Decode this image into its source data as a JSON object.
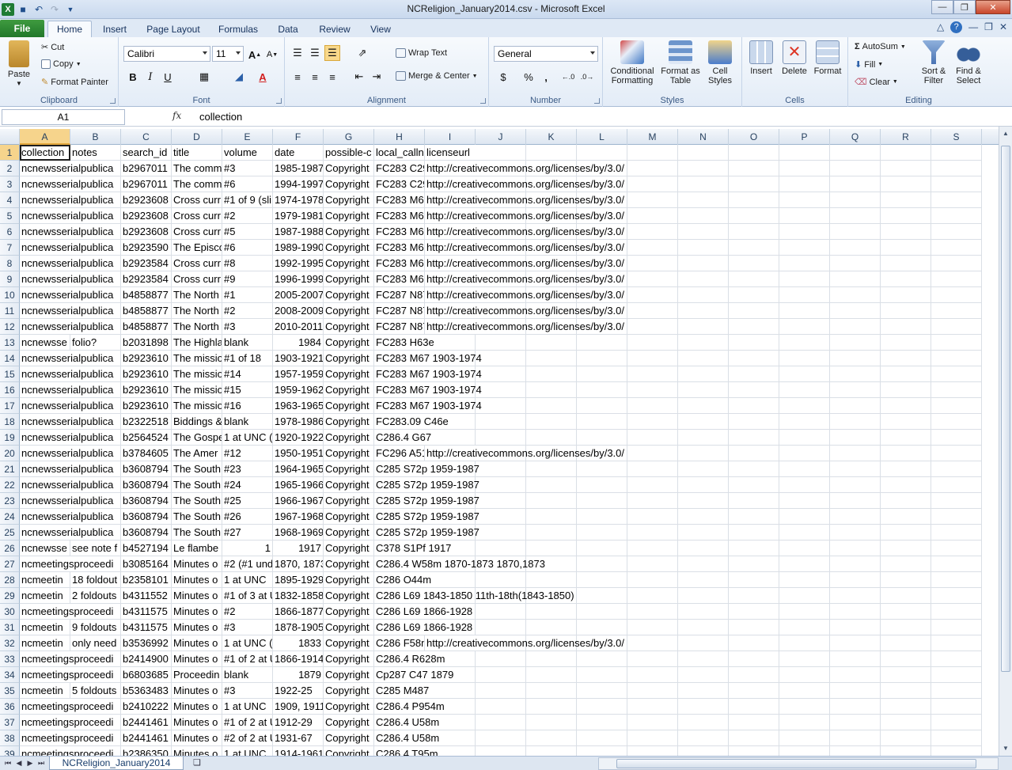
{
  "window": {
    "title": "NCReligion_January2014.csv  -  Microsoft Excel",
    "app_icon": "excel-icon"
  },
  "tabs": {
    "file": "File",
    "items": [
      "Home",
      "Insert",
      "Page Layout",
      "Formulas",
      "Data",
      "Review",
      "View"
    ],
    "active": "Home"
  },
  "ribbon": {
    "clipboard": {
      "label": "Clipboard",
      "paste": "Paste",
      "cut": "Cut",
      "copy": "Copy",
      "format_painter": "Format Painter"
    },
    "font": {
      "label": "Font",
      "name": "Calibri",
      "size": "11",
      "bold": "B",
      "italic": "I",
      "underline": "U"
    },
    "alignment": {
      "label": "Alignment",
      "wrap": "Wrap Text",
      "merge": "Merge & Center"
    },
    "number": {
      "label": "Number",
      "format": "General",
      "currency": "$",
      "percent": "%",
      "comma": ","
    },
    "styles": {
      "label": "Styles",
      "conditional": "Conditional Formatting",
      "format_table": "Format as Table",
      "cell_styles": "Cell Styles"
    },
    "cells": {
      "label": "Cells",
      "insert": "Insert",
      "delete": "Delete",
      "format": "Format"
    },
    "editing": {
      "label": "Editing",
      "autosum": "AutoSum",
      "fill": "Fill",
      "clear": "Clear",
      "sort": "Sort & Filter",
      "find": "Find & Select"
    }
  },
  "formula_bar": {
    "name_box": "A1",
    "fx": "fx",
    "value": "collection"
  },
  "columns": [
    "A",
    "B",
    "C",
    "D",
    "E",
    "F",
    "G",
    "H",
    "I",
    "J",
    "K",
    "L",
    "M",
    "N",
    "O",
    "P",
    "Q",
    "R",
    "S"
  ],
  "rows": [
    {
      "n": "1",
      "c": [
        "collection",
        "notes",
        "search_id",
        "title",
        "volume",
        "date",
        "possible-c",
        "local_calln",
        "licenseurl"
      ]
    },
    {
      "n": "2",
      "c": [
        "ncnewsserialpublica",
        "",
        "b2967011",
        "The comm",
        "#3",
        "1985-1987",
        "Copyright",
        "FC283 C29",
        "http://creativecommons.org/licenses/by/3.0/"
      ]
    },
    {
      "n": "3",
      "c": [
        "ncnewsserialpublica",
        "",
        "b2967011",
        "The comm",
        "#6",
        "1994-1997",
        "Copyright",
        "FC283 C29",
        "http://creativecommons.org/licenses/by/3.0/"
      ]
    },
    {
      "n": "4",
      "c": [
        "ncnewsserialpublica",
        "",
        "b2923608",
        "Cross curr",
        "#1 of 9 (sli",
        "1974-1978",
        "Copyright",
        "FC283 M67",
        "http://creativecommons.org/licenses/by/3.0/"
      ]
    },
    {
      "n": "5",
      "c": [
        "ncnewsserialpublica",
        "",
        "b2923608",
        "Cross curr",
        "#2",
        "1979-1981",
        "Copyright",
        "FC283 M67",
        "http://creativecommons.org/licenses/by/3.0/"
      ]
    },
    {
      "n": "6",
      "c": [
        "ncnewsserialpublica",
        "",
        "b2923608",
        "Cross curr",
        "#5",
        "1987-1988",
        "Copyright",
        "FC283 M67",
        "http://creativecommons.org/licenses/by/3.0/"
      ]
    },
    {
      "n": "7",
      "c": [
        "ncnewsserialpublica",
        "",
        "b2923590",
        "The Episco",
        "#6",
        "1989-1990",
        "Copyright",
        "FC283 M67",
        "http://creativecommons.org/licenses/by/3.0/"
      ]
    },
    {
      "n": "8",
      "c": [
        "ncnewsserialpublica",
        "",
        "b2923584",
        "Cross curr",
        "#8",
        "1992-1995",
        "Copyright",
        "FC283 M67",
        "http://creativecommons.org/licenses/by/3.0/"
      ]
    },
    {
      "n": "9",
      "c": [
        "ncnewsserialpublica",
        "",
        "b2923584",
        "Cross curr",
        "#9",
        "1996-1999",
        "Copyright",
        "FC283 M67",
        "http://creativecommons.org/licenses/by/3.0/"
      ]
    },
    {
      "n": "10",
      "c": [
        "ncnewsserialpublica",
        "",
        "b4858877",
        "The North",
        "#1",
        "2005-2007",
        "Copyright",
        "FC287 N87",
        "http://creativecommons.org/licenses/by/3.0/"
      ]
    },
    {
      "n": "11",
      "c": [
        "ncnewsserialpublica",
        "",
        "b4858877",
        "The North",
        "#2",
        "2008-2009",
        "Copyright",
        "FC287 N87",
        "http://creativecommons.org/licenses/by/3.0/"
      ]
    },
    {
      "n": "12",
      "c": [
        "ncnewsserialpublica",
        "",
        "b4858877",
        "The North",
        "#3",
        "2010-2011",
        "Copyright",
        "FC287 N87",
        "http://creativecommons.org/licenses/by/3.0/"
      ]
    },
    {
      "n": "13",
      "c": [
        "ncnewsse",
        "folio?",
        "b2031898",
        "The Highla",
        "blank",
        "1984",
        "Copyright",
        "FC283 H63e",
        ""
      ]
    },
    {
      "n": "14",
      "c": [
        "ncnewsserialpublica",
        "",
        "b2923610",
        "The missio",
        "#1 of 18",
        "1903-1921",
        "Copyright",
        "FC283 M67 1903-1974",
        ""
      ]
    },
    {
      "n": "15",
      "c": [
        "ncnewsserialpublica",
        "",
        "b2923610",
        "The missio",
        "#14",
        "1957-1959",
        "Copyright",
        "FC283 M67 1903-1974",
        ""
      ]
    },
    {
      "n": "16",
      "c": [
        "ncnewsserialpublica",
        "",
        "b2923610",
        "The missio",
        "#15",
        "1959-1962",
        "Copyright",
        "FC283 M67 1903-1974",
        ""
      ]
    },
    {
      "n": "17",
      "c": [
        "ncnewsserialpublica",
        "",
        "b2923610",
        "The missio",
        "#16",
        "1963-1965",
        "Copyright",
        "FC283 M67 1903-1974",
        ""
      ]
    },
    {
      "n": "18",
      "c": [
        "ncnewsserialpublica",
        "",
        "b2322518",
        "Biddings &",
        "blank",
        "1978-1986",
        "Copyright",
        "FC283.09 C46e",
        ""
      ]
    },
    {
      "n": "19",
      "c": [
        "ncnewsserialpublica",
        "",
        "b2564524",
        "The Gospe",
        "1 at UNC (",
        "1920-1922",
        "Copyright",
        "C286.4 G67",
        ""
      ]
    },
    {
      "n": "20",
      "c": [
        "ncnewsserialpublica",
        "",
        "b3784605",
        "The Amer",
        "#12",
        "1950-1951",
        "Copyright",
        "FC296 A51",
        "http://creativecommons.org/licenses/by/3.0/"
      ]
    },
    {
      "n": "21",
      "c": [
        "ncnewsserialpublica",
        "",
        "b3608794",
        "The South",
        "#23",
        "1964-1965",
        "Copyright",
        "C285 S72p 1959-1987",
        ""
      ]
    },
    {
      "n": "22",
      "c": [
        "ncnewsserialpublica",
        "",
        "b3608794",
        "The South",
        "#24",
        "1965-1966",
        "Copyright",
        "C285 S72p 1959-1987",
        ""
      ]
    },
    {
      "n": "23",
      "c": [
        "ncnewsserialpublica",
        "",
        "b3608794",
        "The South",
        "#25",
        "1966-1967",
        "Copyright",
        "C285 S72p 1959-1987",
        ""
      ]
    },
    {
      "n": "24",
      "c": [
        "ncnewsserialpublica",
        "",
        "b3608794",
        "The South",
        "#26",
        "1967-1968",
        "Copyright",
        "C285 S72p 1959-1987",
        ""
      ]
    },
    {
      "n": "25",
      "c": [
        "ncnewsserialpublica",
        "",
        "b3608794",
        "The South",
        "#27",
        "1968-1969",
        "Copyright",
        "C285 S72p 1959-1987",
        ""
      ]
    },
    {
      "n": "26",
      "c": [
        "ncnewsse",
        "see note f",
        "b4527194",
        "Le flambe",
        "1",
        "1917",
        "Copyright",
        "C378 S1Pf 1917",
        ""
      ]
    },
    {
      "n": "27",
      "c": [
        "ncmeetingsproceedi",
        "",
        "b3085164",
        "Minutes o",
        "#2 (#1 und",
        "1870, 1873",
        "Copyright",
        "C286.4 W58m 1870-1873 1870,1873",
        ""
      ]
    },
    {
      "n": "28",
      "c": [
        "ncmeetin",
        "18 foldout",
        "b2358101",
        "Minutes o",
        "1 at UNC",
        "1895-1929",
        "Copyright",
        "C286 O44m",
        ""
      ]
    },
    {
      "n": "29",
      "c": [
        "ncmeetin",
        "2 foldouts",
        "b4311552",
        "Minutes o",
        "#1 of 3 at U",
        "1832-1858",
        "Copyright",
        "C286 L69 1843-1850 11th-18th(1843-1850)",
        ""
      ]
    },
    {
      "n": "30",
      "c": [
        "ncmeetingsproceedi",
        "",
        "b4311575",
        "Minutes o",
        "#2",
        "1866-1877",
        "Copyright",
        "C286 L69 1866-1928",
        ""
      ]
    },
    {
      "n": "31",
      "c": [
        "ncmeetin",
        "9 foldouts",
        "b4311575",
        "Minutes o",
        "#3",
        "1878-1905",
        "Copyright",
        "C286 L69 1866-1928",
        ""
      ]
    },
    {
      "n": "32",
      "c": [
        "ncmeetin",
        "only need",
        "b3536992",
        "Minutes o",
        "1 at UNC (",
        "1833",
        "Copyright",
        "C286 F58m",
        "http://creativecommons.org/licenses/by/3.0/"
      ]
    },
    {
      "n": "33",
      "c": [
        "ncmeetingsproceedi",
        "",
        "b2414900",
        "Minutes o",
        "#1 of 2 at U",
        "1866-1914",
        "Copyright",
        "C286.4 R628m",
        ""
      ]
    },
    {
      "n": "34",
      "c": [
        "ncmeetingsproceedi",
        "",
        "b6803685",
        "Proceedin",
        "blank",
        "1879",
        "Copyright",
        "Cp287 C47 1879",
        ""
      ]
    },
    {
      "n": "35",
      "c": [
        "ncmeetin",
        "5 foldouts",
        "b5363483",
        "Minutes o",
        "#3",
        "1922-25",
        "Copyright",
        "C285 M487",
        ""
      ]
    },
    {
      "n": "36",
      "c": [
        "ncmeetingsproceedi",
        "",
        "b2410222",
        "Minutes o",
        "1 at UNC",
        "1909, 1911",
        "Copyright",
        "C286.4 P954m",
        ""
      ]
    },
    {
      "n": "37",
      "c": [
        "ncmeetingsproceedi",
        "",
        "b2441461",
        "Minutes o",
        "#1 of 2 at U",
        "1912-29",
        "Copyright",
        "C286.4 U58m",
        ""
      ]
    },
    {
      "n": "38",
      "c": [
        "ncmeetingsproceedi",
        "",
        "b2441461",
        "Minutes o",
        "#2 of 2 at U",
        "1931-67",
        "Copyright",
        "C286.4 U58m",
        ""
      ]
    },
    {
      "n": "39",
      "c": [
        "ncmeetingsproceedi",
        "",
        "b2386350",
        "Minutes o",
        "1 at UNC",
        "1914-1961",
        "Copyright",
        "C286.4 T95m",
        ""
      ]
    }
  ],
  "sheet": {
    "tab": "NCReligion_January2014"
  }
}
